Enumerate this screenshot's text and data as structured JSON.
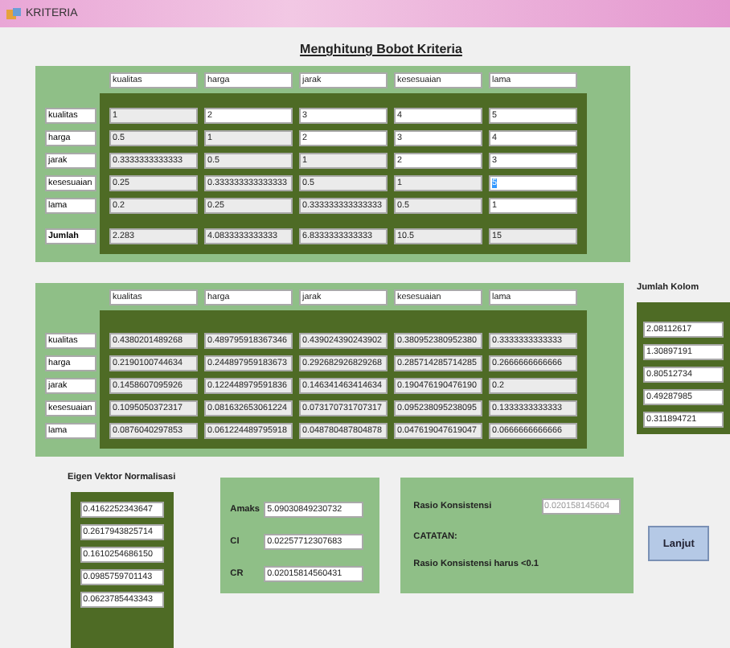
{
  "window": {
    "title": "KRITERIA"
  },
  "heading": "Menghitung Bobot Kriteria",
  "comparison": {
    "columns": [
      "kualitas",
      "harga",
      "jarak",
      "kesesuaian",
      "lama"
    ],
    "rows": [
      {
        "label": "kualitas",
        "cells": [
          {
            "value": "1",
            "readonly": true,
            "selected": false
          },
          {
            "value": "2",
            "readonly": false,
            "selected": false
          },
          {
            "value": "3",
            "readonly": false,
            "selected": false
          },
          {
            "value": "4",
            "readonly": false,
            "selected": false
          },
          {
            "value": "5",
            "readonly": false,
            "selected": false
          }
        ]
      },
      {
        "label": "harga",
        "cells": [
          {
            "value": "0.5",
            "readonly": true,
            "selected": false
          },
          {
            "value": "1",
            "readonly": true,
            "selected": false
          },
          {
            "value": "2",
            "readonly": false,
            "selected": false
          },
          {
            "value": "3",
            "readonly": false,
            "selected": false
          },
          {
            "value": "4",
            "readonly": false,
            "selected": false
          }
        ]
      },
      {
        "label": "jarak",
        "cells": [
          {
            "value": "0.3333333333333",
            "readonly": true,
            "selected": false
          },
          {
            "value": "0.5",
            "readonly": true,
            "selected": false
          },
          {
            "value": "1",
            "readonly": true,
            "selected": false
          },
          {
            "value": "2",
            "readonly": false,
            "selected": false
          },
          {
            "value": "3",
            "readonly": false,
            "selected": false
          }
        ]
      },
      {
        "label": "kesesuaian",
        "cells": [
          {
            "value": "0.25",
            "readonly": true,
            "selected": false
          },
          {
            "value": "0.333333333333333",
            "readonly": true,
            "selected": false
          },
          {
            "value": "0.5",
            "readonly": true,
            "selected": false
          },
          {
            "value": "1",
            "readonly": true,
            "selected": false
          },
          {
            "value": "5",
            "readonly": false,
            "selected": true
          }
        ]
      },
      {
        "label": "lama",
        "cells": [
          {
            "value": "0.2",
            "readonly": true,
            "selected": false
          },
          {
            "value": "0.25",
            "readonly": true,
            "selected": false
          },
          {
            "value": "0.333333333333333",
            "readonly": true,
            "selected": false
          },
          {
            "value": "0.5",
            "readonly": true,
            "selected": false
          },
          {
            "value": "1",
            "readonly": false,
            "selected": false
          }
        ]
      }
    ],
    "total": {
      "label": "Jumlah",
      "cells": [
        "2.283",
        "4.0833333333333",
        "6.8333333333333",
        "10.5",
        "15"
      ]
    }
  },
  "normalized": {
    "columns": [
      "kualitas",
      "harga",
      "jarak",
      "kesesuaian",
      "lama"
    ],
    "rows": [
      {
        "label": "kualitas",
        "cells": [
          "0.4380201489268",
          "0.489795918367346",
          "0.439024390243902",
          "0.380952380952380",
          "0.3333333333333"
        ]
      },
      {
        "label": "harga",
        "cells": [
          "0.2190100744634",
          "0.244897959183673",
          "0.292682926829268",
          "0.285714285714285",
          "0.2666666666666"
        ]
      },
      {
        "label": "jarak",
        "cells": [
          "0.1458607095926",
          "0.122448979591836",
          "0.146341463414634",
          "0.190476190476190",
          "0.2"
        ]
      },
      {
        "label": "kesesuaian",
        "cells": [
          "0.1095050372317",
          "0.081632653061224",
          "0.073170731707317",
          "0.095238095238095",
          "0.1333333333333"
        ]
      },
      {
        "label": "lama",
        "cells": [
          "0.0876040297853",
          "0.061224489795918",
          "0.048780487804878",
          "0.047619047619047",
          "0.0666666666666"
        ]
      }
    ]
  },
  "column_sums": {
    "title": "Jumlah Kolom",
    "values": [
      "2.08112617",
      "1.30897191",
      "0.80512734",
      "0.49287985",
      "0.311894721"
    ]
  },
  "eigen_vector": {
    "title": "Eigen Vektor Normalisasi",
    "values": [
      "0.4162252343647",
      "0.2617943825714",
      "0.1610254686150",
      "0.0985759701143",
      "0.0623785443343"
    ]
  },
  "consistency": [
    {
      "label": "Amaks",
      "value": "5.09030849230732"
    },
    {
      "label": "CI",
      "value": "0.02257712307683"
    },
    {
      "label": "CR",
      "value": "0.02015814560431"
    }
  ],
  "ratio": {
    "label": "Rasio Konsistensi",
    "value": "0.020158145604",
    "disabled": true,
    "note_title": "CATATAN:",
    "note": "Rasio Konsistensi harus <0.1"
  },
  "buttons": [
    {
      "label": "Lanjut"
    }
  ]
}
